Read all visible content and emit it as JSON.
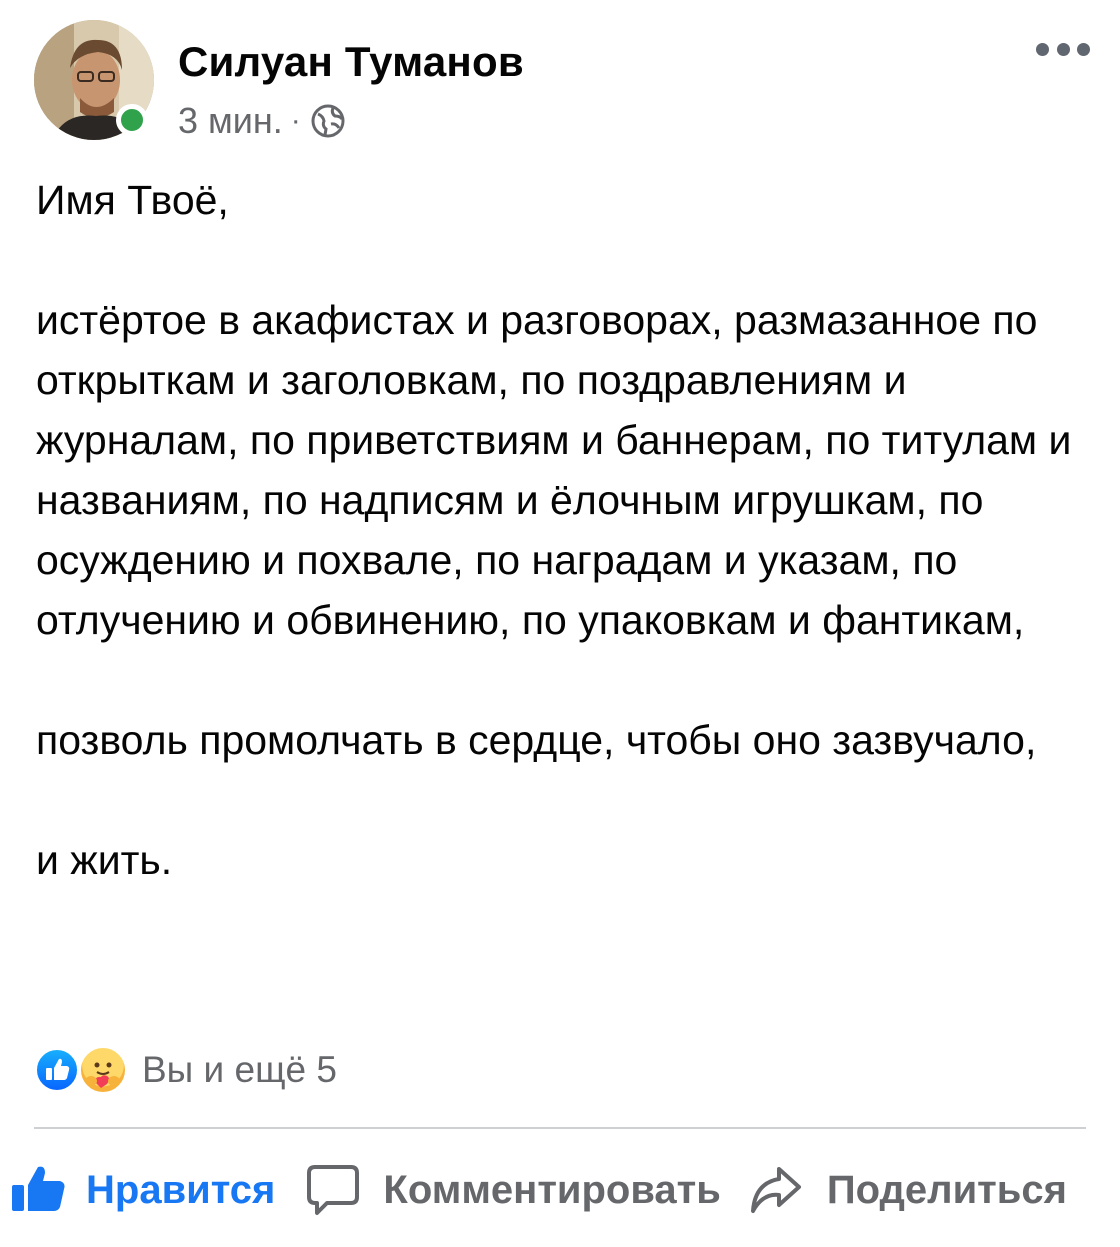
{
  "post": {
    "author_name": "Силуан Туманов",
    "time": "3 мин.",
    "separator": "·",
    "privacy_icon": "globe-icon",
    "more_icon": "ellipsis-icon",
    "online": true,
    "paragraphs": [
      "Имя Твоё,",
      "истёртое в акафистах и разговорах, размазанное по открыткам и заголовкам, по поздравлениям и журналам, по приветствиям и баннерам, по титулам и названиям, по надписям и ёлочным игрушкам, по осуждению и похвале, по наградам и указам, по отлучению и обвинению, по упаковкам и фантикам,",
      "позволь промолчать в сердце, чтобы оно зазвучало,",
      "и жить."
    ]
  },
  "reactions": {
    "icons": [
      "like-reaction-icon",
      "care-reaction-icon"
    ],
    "summary": "Вы и ещё 5"
  },
  "actions": {
    "like_label": "Нравится",
    "comment_label": "Комментировать",
    "share_label": "Поделиться"
  },
  "colors": {
    "like_active": "#1877f2",
    "secondary_text": "#65676b",
    "online_green": "#31a24c",
    "divider": "#ced0d4"
  }
}
